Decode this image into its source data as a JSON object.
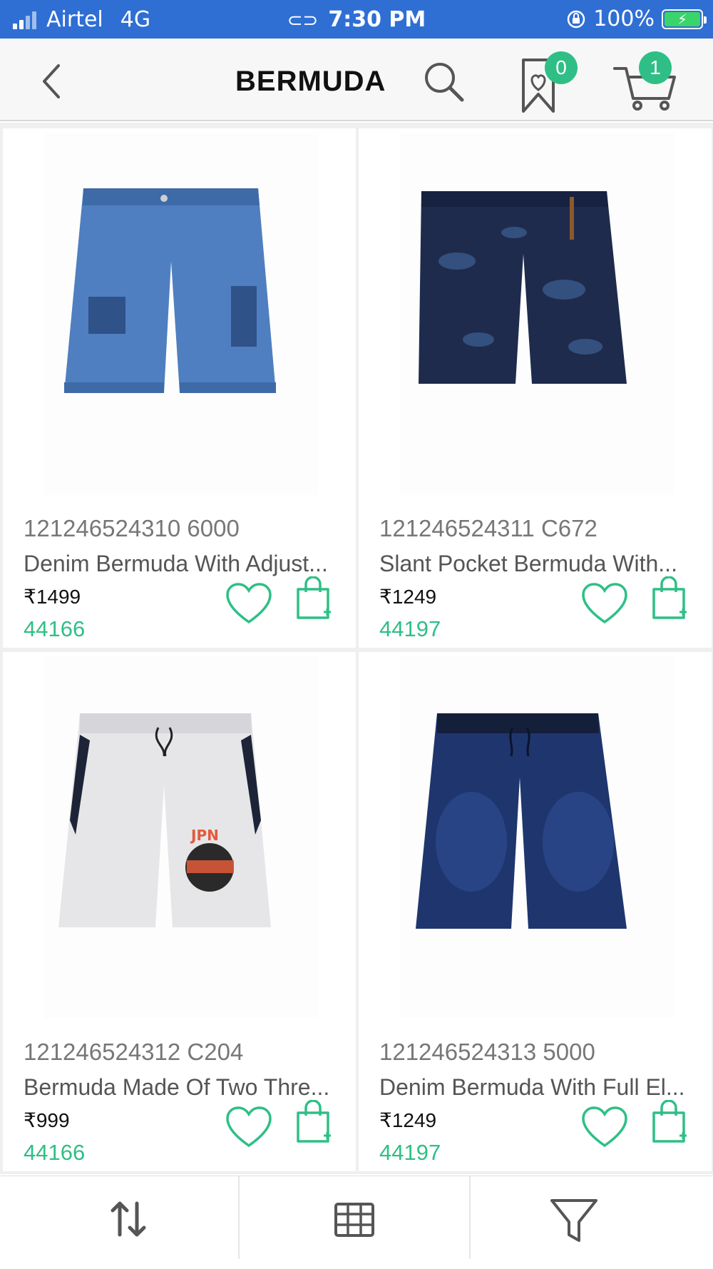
{
  "status_bar": {
    "carrier": "Airtel",
    "network": "4G",
    "time": "7:30 PM",
    "battery": "100%",
    "icons": [
      "signal-icon",
      "link-icon",
      "orientation-lock-icon",
      "battery-charging-icon"
    ]
  },
  "header": {
    "title": "BERMUDA",
    "wishlist_count": "0",
    "cart_count": "1",
    "icons": [
      "back-icon",
      "search-icon",
      "wishlist-bookmark-icon",
      "cart-icon"
    ]
  },
  "products": [
    {
      "sku": "121246524310 6000",
      "name": "Denim Bermuda With Adjust...",
      "price": "₹1499",
      "points": "44166",
      "image": "light-blue-distressed-denim-shorts"
    },
    {
      "sku": "121246524311 C672",
      "name": "Slant Pocket Bermuda With...",
      "price": "₹1249",
      "points": "44197",
      "image": "navy-camo-print-shorts"
    },
    {
      "sku": "121246524312 C204",
      "name": "Bermuda Made Of Two Thre...",
      "price": "₹999",
      "points": "44166",
      "image": "grey-melange-jogger-shorts"
    },
    {
      "sku": "121246524313 5000",
      "name": "Denim Bermuda With Full El...",
      "price": "₹1249",
      "points": "44197",
      "image": "dark-blue-denim-elastic-shorts"
    }
  ],
  "bottom_bar": {
    "icons": [
      "sort-icon",
      "grid-view-icon",
      "filter-icon"
    ]
  },
  "colors": {
    "status_bar": "#2f6fd4",
    "accent_green": "#2fbf86"
  }
}
